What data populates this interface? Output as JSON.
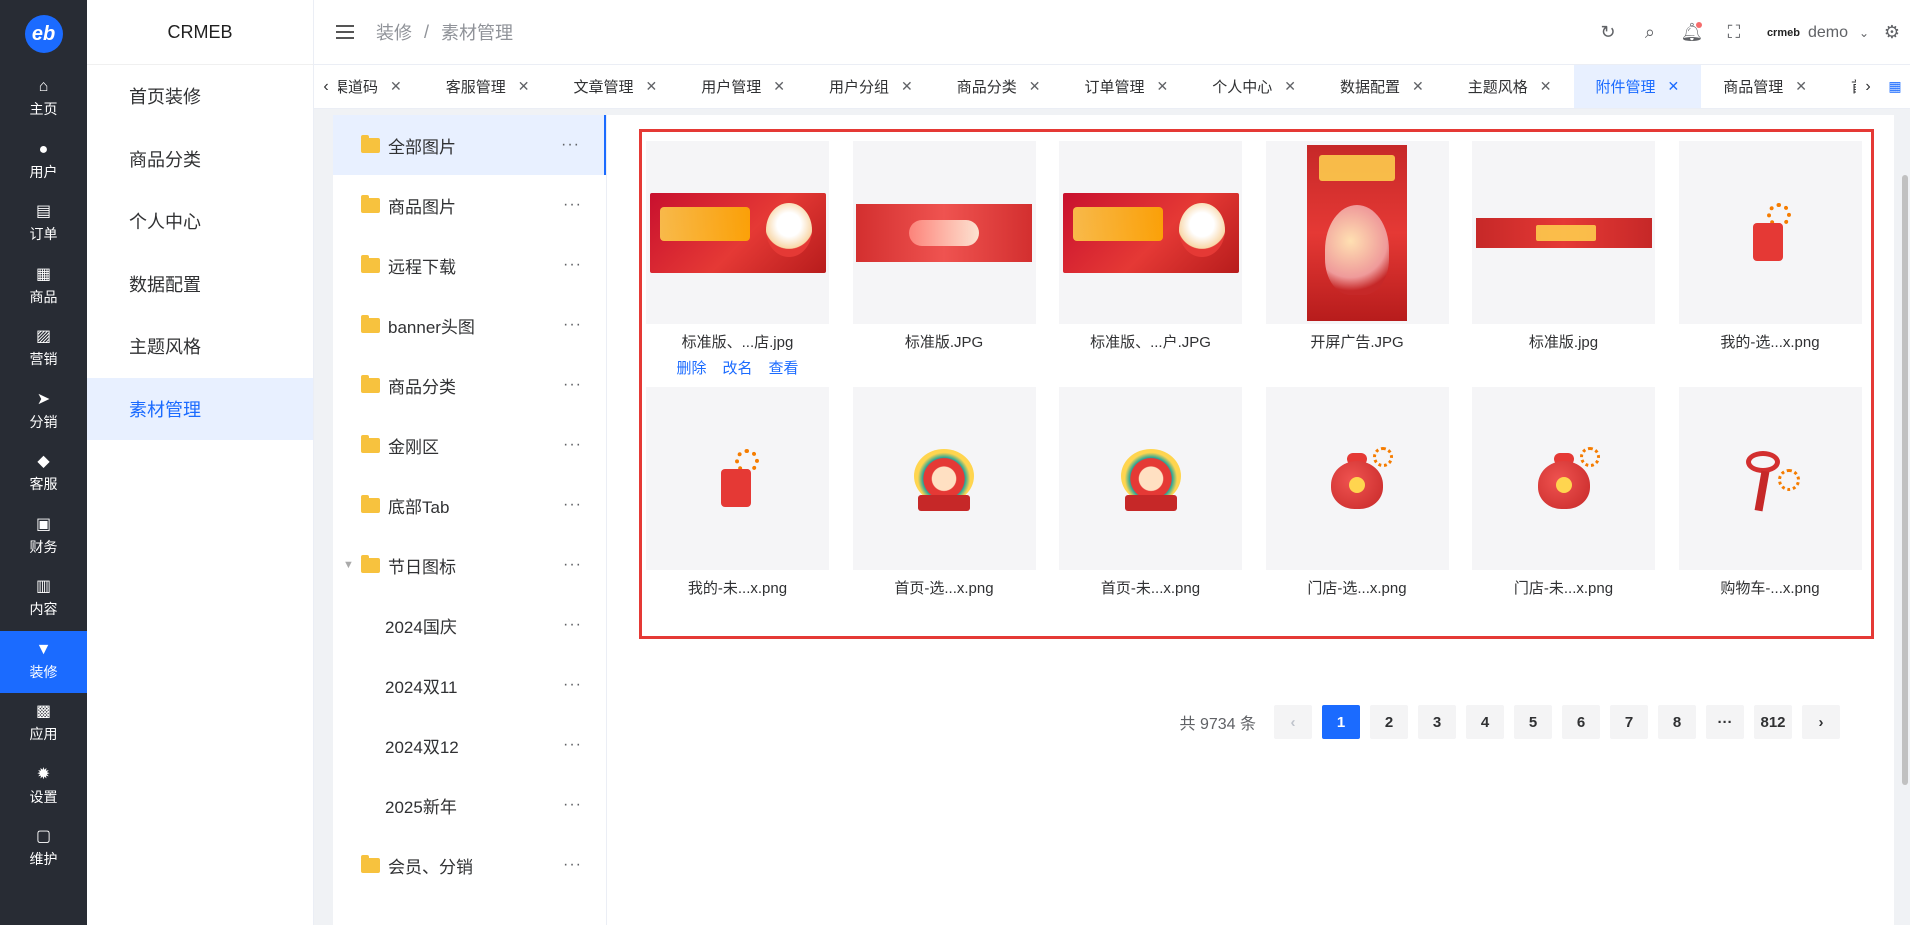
{
  "rail": {
    "logo": "eb",
    "items": [
      {
        "label": "主页",
        "icon": "home-icon",
        "glyph": "⌂"
      },
      {
        "label": "用户",
        "icon": "user-icon",
        "glyph": "●"
      },
      {
        "label": "订单",
        "icon": "order-icon",
        "glyph": "▤"
      },
      {
        "label": "商品",
        "icon": "goods-icon",
        "glyph": "▦"
      },
      {
        "label": "营销",
        "icon": "marketing-icon",
        "glyph": "▨"
      },
      {
        "label": "分销",
        "icon": "distribution-icon",
        "glyph": "➤"
      },
      {
        "label": "客服",
        "icon": "service-icon",
        "glyph": "◆"
      },
      {
        "label": "财务",
        "icon": "wallet-icon",
        "glyph": "▣"
      },
      {
        "label": "内容",
        "icon": "content-icon",
        "glyph": "▥"
      },
      {
        "label": "装修",
        "icon": "decorate-icon",
        "glyph": "▼"
      },
      {
        "label": "应用",
        "icon": "apps-icon",
        "glyph": "▩"
      },
      {
        "label": "设置",
        "icon": "settings-icon",
        "glyph": "✹"
      },
      {
        "label": "维护",
        "icon": "maintenance-icon",
        "glyph": "▢"
      }
    ],
    "active_index": 9
  },
  "sidebar": {
    "title": "CRMEB",
    "items": [
      "首页装修",
      "商品分类",
      "个人中心",
      "数据配置",
      "主题风格",
      "素材管理"
    ],
    "active_index": 5
  },
  "header": {
    "breadcrumb": [
      "装修",
      "素材管理"
    ],
    "separator": "/",
    "brand_mini": "crmeb",
    "user": "demo"
  },
  "tabs": {
    "items": [
      "公众号渠道码",
      "客服管理",
      "文章管理",
      "用户管理",
      "用户分组",
      "商品分类",
      "订单管理",
      "个人中心",
      "数据配置",
      "主题风格",
      "附件管理",
      "商品管理",
      "首页"
    ],
    "active_index": 10
  },
  "tree": {
    "nodes": [
      {
        "label": "全部图片",
        "level": 1,
        "folder": true,
        "active": true
      },
      {
        "label": "商品图片",
        "level": 1,
        "folder": true
      },
      {
        "label": "远程下载",
        "level": 1,
        "folder": true
      },
      {
        "label": "banner头图",
        "level": 1,
        "folder": true
      },
      {
        "label": "商品分类",
        "level": 1,
        "folder": true
      },
      {
        "label": "金刚区",
        "level": 1,
        "folder": true
      },
      {
        "label": "底部Tab",
        "level": 1,
        "folder": true
      },
      {
        "label": "节日图标",
        "level": 1,
        "folder": true,
        "expanded": true
      },
      {
        "label": "2024国庆",
        "level": 2,
        "folder": false
      },
      {
        "label": "2024双11",
        "level": 2,
        "folder": false
      },
      {
        "label": "2024双12",
        "level": 2,
        "folder": false
      },
      {
        "label": "2025新年",
        "level": 2,
        "folder": false
      },
      {
        "label": "会员、分销",
        "level": 1,
        "folder": true
      }
    ],
    "more_glyph": "···"
  },
  "images": [
    {
      "name": "标准版、...店.jpg",
      "kind": "banner"
    },
    {
      "name": "标准版.JPG",
      "kind": "banner2"
    },
    {
      "name": "标准版、...户.JPG",
      "kind": "banner"
    },
    {
      "name": "开屏广告.JPG",
      "kind": "poster"
    },
    {
      "name": "标准版.jpg",
      "kind": "strip"
    },
    {
      "name": "我的-选...x.png",
      "kind": "cup"
    },
    {
      "name": "我的-未...x.png",
      "kind": "cup"
    },
    {
      "name": "首页-选...x.png",
      "kind": "lion"
    },
    {
      "name": "首页-未...x.png",
      "kind": "lion"
    },
    {
      "name": "门店-选...x.png",
      "kind": "bag"
    },
    {
      "name": "门店-未...x.png",
      "kind": "bag"
    },
    {
      "name": "购物车-...x.png",
      "kind": "knot"
    }
  ],
  "image_actions": {
    "delete": "删除",
    "rename": "改名",
    "view": "查看"
  },
  "pagination": {
    "total_text": "共 9734 条",
    "pages": [
      "1",
      "2",
      "3",
      "4",
      "5",
      "6",
      "7",
      "8",
      "···",
      "812"
    ],
    "active": "1",
    "prev": "‹",
    "next": "›"
  },
  "colors": {
    "accent": "#1b6bff",
    "rail": "#282c34",
    "highlight": "#e53935"
  }
}
